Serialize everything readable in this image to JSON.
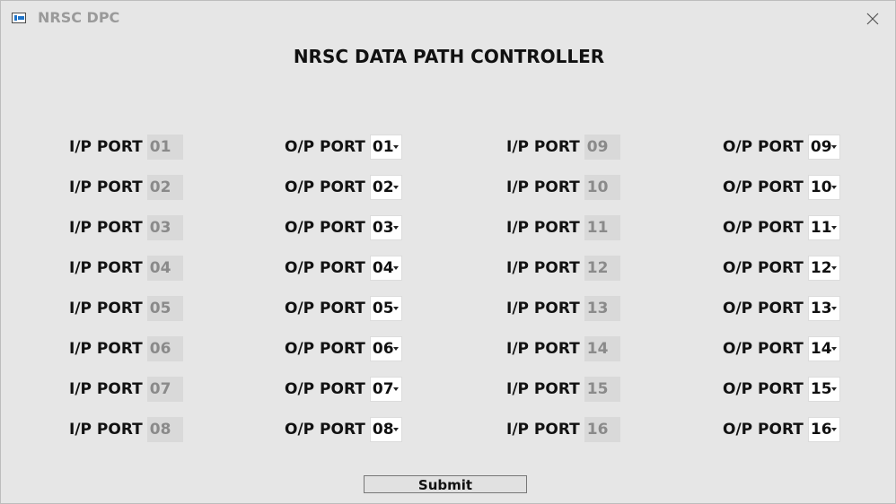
{
  "window": {
    "title": "NRSC DPC",
    "icon": "app-window-icon",
    "close_icon": "close-icon"
  },
  "heading": "NRSC DATA PATH CONTROLLER",
  "labels": {
    "input": "I/P PORT",
    "output": "O/P PORT"
  },
  "rows": [
    {
      "in_a": "01",
      "out_a": "01",
      "in_b": "09",
      "out_b": "09"
    },
    {
      "in_a": "02",
      "out_a": "02",
      "in_b": "10",
      "out_b": "10"
    },
    {
      "in_a": "03",
      "out_a": "03",
      "in_b": "11",
      "out_b": "11"
    },
    {
      "in_a": "04",
      "out_a": "04",
      "in_b": "12",
      "out_b": "12"
    },
    {
      "in_a": "05",
      "out_a": "05",
      "in_b": "13",
      "out_b": "13"
    },
    {
      "in_a": "06",
      "out_a": "06",
      "in_b": "14",
      "out_b": "14"
    },
    {
      "in_a": "07",
      "out_a": "07",
      "in_b": "15",
      "out_b": "15"
    },
    {
      "in_a": "08",
      "out_a": "08",
      "in_b": "16",
      "out_b": "16"
    }
  ],
  "submit_label": "Submit",
  "colors": {
    "background": "#e6e6e6",
    "input_field": "#d9d9d9",
    "input_text": "#8a8a8a",
    "select_bg": "#ffffff",
    "title_text": "#9a9a9a"
  }
}
